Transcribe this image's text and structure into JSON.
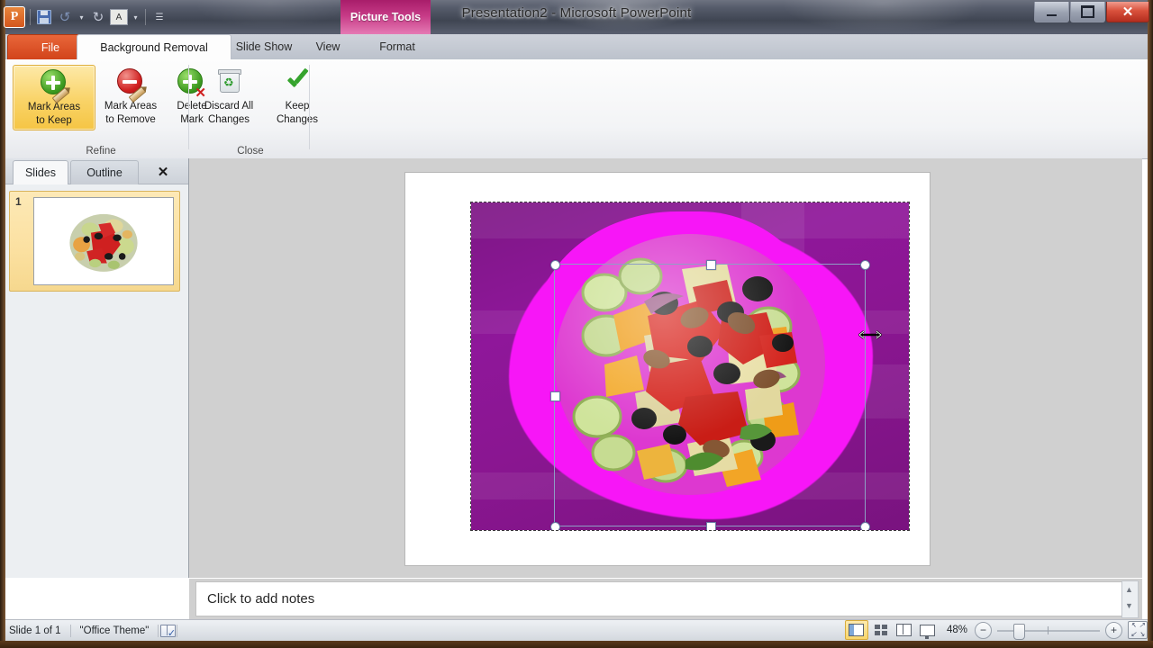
{
  "window": {
    "title": "Presentation2  -  Microsoft PowerPoint",
    "contextual_tab": "Picture Tools",
    "minimize_label": "Minimize",
    "maximize_label": "Maximize",
    "close_label": "✕"
  },
  "quick_access": {
    "app_logo": "P",
    "items": [
      {
        "name": "save-icon",
        "label": "Save"
      },
      {
        "name": "undo-icon",
        "label": "Undo"
      },
      {
        "name": "undo-dropdown-icon",
        "label": "▾"
      },
      {
        "name": "redo-icon",
        "label": "Redo"
      },
      {
        "name": "font-icon",
        "label": "A"
      },
      {
        "name": "font-dropdown-icon",
        "label": "▾"
      },
      {
        "name": "customize-qat-icon",
        "label": "▾"
      }
    ]
  },
  "tabs": [
    {
      "id": "file",
      "label": "File"
    },
    {
      "id": "background-removal",
      "label": "Background Removal"
    },
    {
      "id": "slide-show",
      "label": "Slide Show"
    },
    {
      "id": "view",
      "label": "View"
    },
    {
      "id": "format",
      "label": "Format"
    }
  ],
  "tab_right": {
    "collapse_ribbon": "⌃",
    "help": "?"
  },
  "ribbon": {
    "groups": [
      {
        "id": "refine",
        "label": "Refine",
        "buttons": [
          {
            "id": "mark-areas-to-keep",
            "line1": "Mark Areas",
            "line2": "to Keep",
            "icon": "mark-keep-icon",
            "active": true
          },
          {
            "id": "mark-areas-to-remove",
            "line1": "Mark Areas",
            "line2": "to Remove",
            "icon": "mark-remove-icon",
            "active": false
          },
          {
            "id": "delete-mark",
            "line1": "Delete",
            "line2": "Mark",
            "icon": "delete-mark-icon",
            "active": false
          }
        ]
      },
      {
        "id": "close",
        "label": "Close",
        "buttons": [
          {
            "id": "discard-all-changes",
            "line1": "Discard All",
            "line2": "Changes",
            "icon": "trash-icon",
            "active": false
          },
          {
            "id": "keep-changes",
            "line1": "Keep",
            "line2": "Changes",
            "icon": "checkmark-icon",
            "active": false
          }
        ]
      }
    ]
  },
  "slide_pane": {
    "tabs": [
      {
        "id": "slides",
        "label": "Slides",
        "selected": true
      },
      {
        "id": "outline",
        "label": "Outline",
        "selected": false
      }
    ],
    "close_label": "✕",
    "thumbnails": [
      {
        "number": "1",
        "selected": true
      }
    ]
  },
  "notes": {
    "placeholder": "Click to add notes",
    "scroll_up": "▲",
    "scroll_down": "▼"
  },
  "status_bar": {
    "slide_count": "Slide 1 of 1",
    "theme": "\"Office Theme\"",
    "spellcheck_icon": "spellcheck-icon",
    "views": [
      {
        "id": "normal",
        "label": "Normal View",
        "selected": true
      },
      {
        "id": "slide-sorter",
        "label": "Slide Sorter",
        "selected": false
      },
      {
        "id": "reading",
        "label": "Reading View",
        "selected": false
      },
      {
        "id": "slide-show",
        "label": "Slide Show",
        "selected": false
      }
    ],
    "zoom_level": "48%",
    "zoom_out": "−",
    "zoom_in": "+",
    "fit_to_window": "fit-slide-icon"
  },
  "canvas": {
    "image_alt": "salad-photo",
    "background_removal_color": "#f716f7",
    "retained_overlay_color": "#8f179a",
    "selection": {
      "handles": 8,
      "resize_cursor": "horizontal-resize-cursor"
    }
  },
  "colors": {
    "accent_orange": "#d2441a",
    "contextual_pink": "#c63a86",
    "highlight_yellow": "#f8d66c",
    "magenta": "#f716f7",
    "purple": "#8f179a"
  }
}
